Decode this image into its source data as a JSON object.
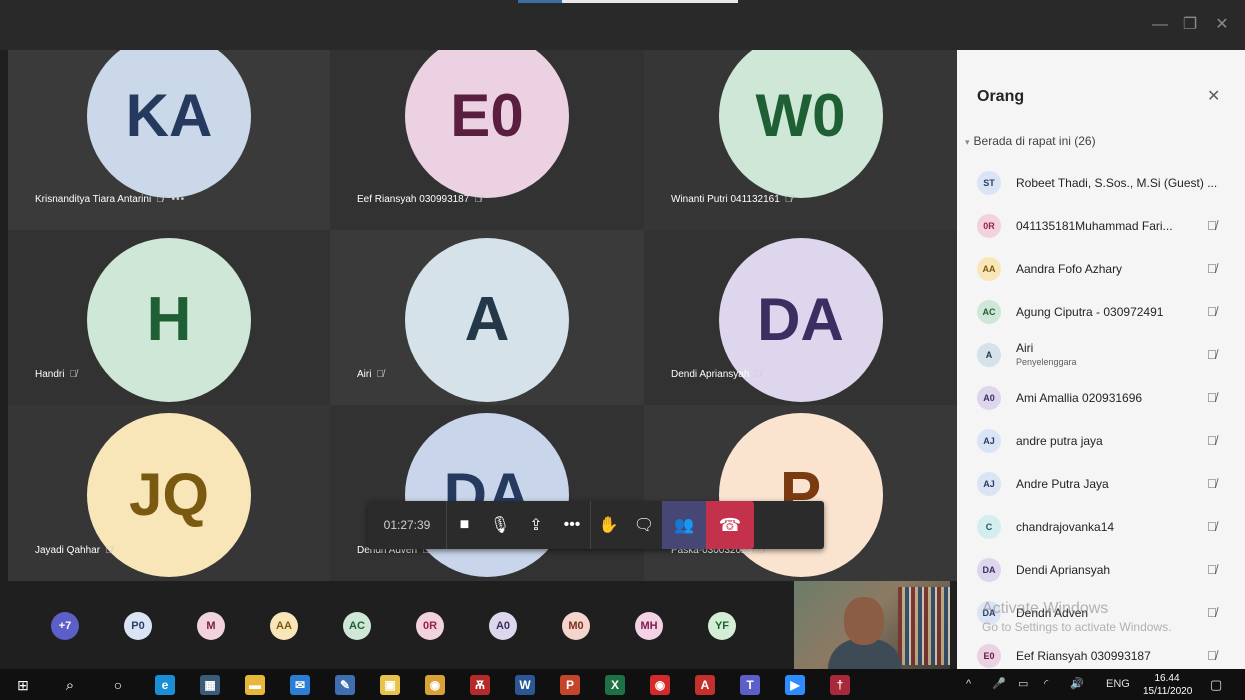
{
  "window": {
    "minimize_glyph": "—",
    "restore_glyph": "❐",
    "close_glyph": "✕"
  },
  "grid": {
    "tiles": [
      {
        "initials": "KA",
        "name": "Krisnanditya Tiara Antarini",
        "bg": "#cbd8ea",
        "fg": "#263a60",
        "more": "•••"
      },
      {
        "initials": "E0",
        "name": "Eef Riansyah 030993187",
        "bg": "#ecd1e3",
        "fg": "#5a1f3e"
      },
      {
        "initials": "W0",
        "name": "Winanti Putri 041132161",
        "bg": "#cfe7d6",
        "fg": "#1f5f34"
      },
      {
        "initials": "H",
        "name": "Handri",
        "bg": "#cfe7d6",
        "fg": "#1f5f34"
      },
      {
        "initials": "A",
        "name": "Airi",
        "bg": "#d5e2e9",
        "fg": "#23394a"
      },
      {
        "initials": "DA",
        "name": "Dendi Apriansyah",
        "bg": "#ddd6ec",
        "fg": "#3b2f62"
      },
      {
        "initials": "JQ",
        "name": "Jayadi Qahhar",
        "bg": "#f8e6b8",
        "fg": "#7a5a10"
      },
      {
        "initials": "DA",
        "name": "Dendri Adven",
        "bg": "#c9d5ea",
        "fg": "#263a60"
      },
      {
        "initials": "P",
        "name": "Paska-030032023",
        "bg": "#fbe4cf",
        "fg": "#7a3b10"
      }
    ]
  },
  "controls": {
    "timer": "01:27:39",
    "camera_glyph": "■",
    "mic_glyph": "🎙",
    "share_glyph": "⇪",
    "more_glyph": "•••",
    "raise_hand_glyph": "✋",
    "chat_glyph": "🗨",
    "people_glyph": "👥",
    "hangup_glyph": "☎"
  },
  "overflow": {
    "chips": [
      {
        "label": "+7",
        "bg": "#5b5fc7",
        "fg": "#ffffff"
      },
      {
        "label": "P0",
        "bg": "#dbe4f4",
        "fg": "#2b3e6a"
      },
      {
        "label": "M",
        "bg": "#f2d2dc",
        "fg": "#7a1f3e"
      },
      {
        "label": "AA",
        "bg": "#f8e6b8",
        "fg": "#7a5a10"
      },
      {
        "label": "AC",
        "bg": "#cfe7d6",
        "fg": "#1f5f34"
      },
      {
        "label": "0R",
        "bg": "#f2d2dc",
        "fg": "#9a2050"
      },
      {
        "label": "A0",
        "bg": "#ddd6ec",
        "fg": "#3b2f62"
      },
      {
        "label": "M0",
        "bg": "#f4d5cd",
        "fg": "#7a2e1e"
      },
      {
        "label": "MH",
        "bg": "#f2d2e4",
        "fg": "#7a1f4e"
      },
      {
        "label": "YF",
        "bg": "#d4eed6",
        "fg": "#1f5f34"
      }
    ]
  },
  "panel": {
    "title": "Orang",
    "close_glyph": "✕",
    "section_caret": "▾",
    "section_label": "Berada di rapat ini (26)",
    "mute_glyph": "🎙̸",
    "people": [
      {
        "initials": "ST",
        "name": "Robeet Thadi, S.Sos., M.Si (Guest) ...",
        "bg": "#dbe4f4",
        "fg": "#2b3e6a",
        "muted": false
      },
      {
        "initials": "0R",
        "name": "041135181Muhammad Fari...",
        "bg": "#f2d2dc",
        "fg": "#9a2050",
        "muted": true
      },
      {
        "initials": "AA",
        "name": "Aandra Fofo Azhary",
        "bg": "#f8e6b8",
        "fg": "#7a5a10",
        "muted": true
      },
      {
        "initials": "AC",
        "name": "Agung Ciputra - 030972491",
        "bg": "#cfe7d6",
        "fg": "#1f5f34",
        "muted": true
      },
      {
        "initials": "A",
        "name": "Airi",
        "role": "Penyelenggara",
        "bg": "#d5e2e9",
        "fg": "#23394a",
        "muted": true
      },
      {
        "initials": "A0",
        "name": "Ami Amallia 020931696",
        "bg": "#ddd6ec",
        "fg": "#3b2f62",
        "muted": true
      },
      {
        "initials": "AJ",
        "name": "andre putra jaya",
        "bg": "#dbe4f4",
        "fg": "#2b3e6a",
        "muted": true
      },
      {
        "initials": "AJ",
        "name": "Andre Putra Jaya",
        "bg": "#dbe4f4",
        "fg": "#2b3e6a",
        "muted": true
      },
      {
        "initials": "C",
        "name": "chandrajovanka14",
        "bg": "#d4eef0",
        "fg": "#1f5a60",
        "muted": true
      },
      {
        "initials": "DA",
        "name": "Dendi Apriansyah",
        "bg": "#ddd6ec",
        "fg": "#3b2f62",
        "muted": true
      },
      {
        "initials": "DA",
        "name": "Dendri Adven",
        "bg": "#dbe4f4",
        "fg": "#2b3e6a",
        "muted": true
      },
      {
        "initials": "E0",
        "name": "Eef Riansyah 030993187",
        "bg": "#ecd1e3",
        "fg": "#5a1f3e",
        "muted": true
      }
    ],
    "watermark_line1": "Activate Windows",
    "watermark_line2": "Go to Settings to activate Windows."
  },
  "taskbar": {
    "start_glyph": "⊞",
    "search_glyph": "⌕",
    "cortana_glyph": "○",
    "apps": [
      {
        "icon": "edge-icon",
        "glyph": "e",
        "bg": "#1a8fd6"
      },
      {
        "icon": "taskview-icon",
        "glyph": "▦",
        "bg": "#3a5b7a"
      },
      {
        "icon": "explorer-icon",
        "glyph": "▬",
        "bg": "#e7b73a"
      },
      {
        "icon": "mail-icon",
        "glyph": "✉",
        "bg": "#2a7fd4"
      },
      {
        "icon": "pen-icon",
        "glyph": "✎",
        "bg": "#3f6fb0"
      },
      {
        "icon": "store-icon",
        "glyph": "▣",
        "bg": "#e8c34a"
      },
      {
        "icon": "chrome-icon",
        "glyph": "◉",
        "bg": "#d8a13a"
      },
      {
        "icon": "app-red-icon",
        "glyph": "Ѫ",
        "bg": "#b22a2a"
      },
      {
        "icon": "word-icon",
        "glyph": "W",
        "bg": "#2b5797"
      },
      {
        "icon": "powerpoint-icon",
        "glyph": "P",
        "bg": "#c4452b"
      },
      {
        "icon": "excel-icon",
        "glyph": "X",
        "bg": "#1e7145"
      },
      {
        "icon": "record-icon",
        "glyph": "◉",
        "bg": "#d42a2a"
      },
      {
        "icon": "acrobat-icon",
        "glyph": "A",
        "bg": "#c4302b"
      },
      {
        "icon": "teams-icon",
        "glyph": "T",
        "bg": "#5b5fc7"
      },
      {
        "icon": "zoom-icon",
        "glyph": "▶",
        "bg": "#2d8cff"
      },
      {
        "icon": "app-red2-icon",
        "glyph": "†",
        "bg": "#a82a3a"
      }
    ],
    "tray_chevron": "^",
    "tray_mic": "🎤",
    "tray_net": "▭",
    "tray_wifi": "◜",
    "tray_vol": "🔊",
    "lang": "ENG",
    "time": "16.44",
    "date": "15/11/2020",
    "notif_glyph": "▢"
  }
}
